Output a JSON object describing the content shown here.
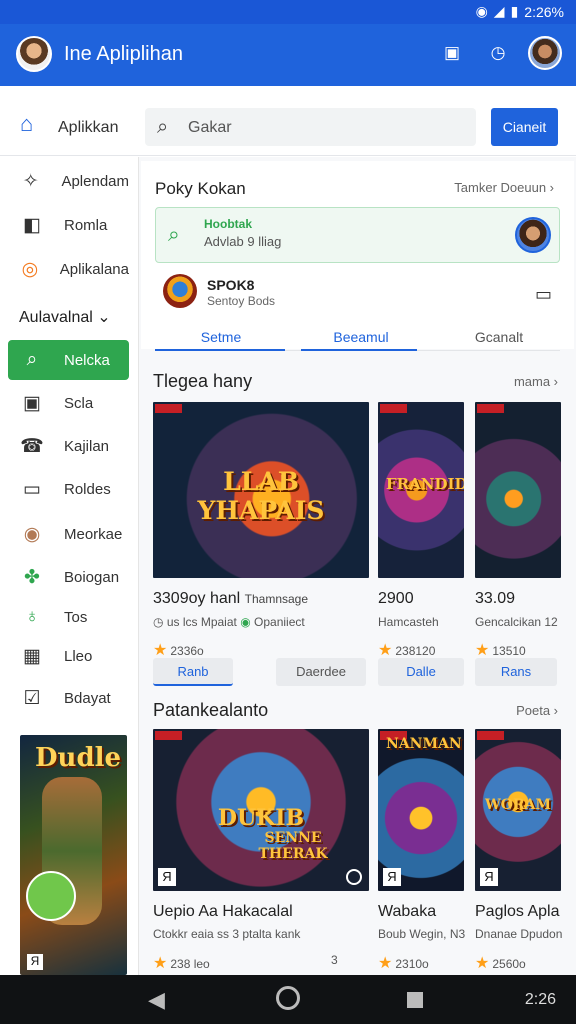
{
  "status": {
    "battery": "2:26%"
  },
  "app": {
    "title": "Ine Apliplihan",
    "icons": [
      "portrait-frame-icon",
      "clock-icon",
      "user-avatar"
    ]
  },
  "top_strip": {
    "label": "Aplikkan",
    "search_placeholder": "Gakar",
    "button": "Cianeit"
  },
  "sidebar": {
    "items": [
      {
        "label": "Aplendam",
        "icon": "puzzle-icon"
      },
      {
        "label": "Romla",
        "icon": "lock-icon"
      },
      {
        "label": "Aplikalana",
        "icon": "refresh-icon"
      }
    ],
    "section": "Aulavalnal",
    "more_items": [
      {
        "label": "Nelcka",
        "icon": "search-icon",
        "active": true
      },
      {
        "label": "Scla",
        "icon": "inbox-icon"
      },
      {
        "label": "Kajilan",
        "icon": "phone-icon"
      },
      {
        "label": "Roldes",
        "icon": "card-icon"
      },
      {
        "label": "Meorkae",
        "icon": "avatar-icon"
      },
      {
        "label": "Boiogan",
        "icon": "puzzle-icon"
      },
      {
        "label": "Tos",
        "icon": "pin-icon"
      },
      {
        "label": "Lleo",
        "icon": "grid-icon"
      },
      {
        "label": "Bdayat",
        "icon": "check-icon"
      }
    ],
    "promo_title": "Dudle"
  },
  "header_card": {
    "title": "Poky Kokan",
    "link": "Tamker Doeuun ›",
    "notice_heading": "Hoobtak",
    "notice_text": "Advlab 9 lliag",
    "row_title": "SPOK8",
    "row_sub": "Sentoy Bods",
    "tabs": [
      "Setme",
      "Beeamul",
      "Gcanalt"
    ]
  },
  "section1": {
    "title": "Tlegea hany",
    "link": "mama ›",
    "games": [
      {
        "cover_text": "LLAB YHAPAIS",
        "title": "3309oy hanl",
        "title_extra": "Thamnsage",
        "sub": "us lcs Mpaiat",
        "sub_extra": "Opaniiect",
        "rating": "2336o",
        "btn": "Ranb",
        "btn2": "Daerdee"
      },
      {
        "cover_text": "FRANDIDER",
        "title": "2900",
        "sub": "Hamcasteh",
        "rating": "238120",
        "btn": "Dalle"
      },
      {
        "title": "33.09",
        "sub": "Gencalcikan 12",
        "rating": "13510",
        "btn": "Rans"
      }
    ]
  },
  "section2": {
    "title": "Patankealanto",
    "link": "Poeta ›",
    "games": [
      {
        "cover_text": "DUKIB",
        "cover_text2": "SENNE THERAK",
        "title": "Uepio Aa Hakacalal",
        "sub": "Ctokkr eaia ss 3 ptalta kank",
        "rating": "238 leo",
        "side": "3"
      },
      {
        "cover_text": "NANMAN",
        "title": "Wabaka",
        "sub": "Boub Wegin, N3",
        "rating": "2310o"
      },
      {
        "cover_text": "WORAM",
        "title": "Paglos Apla",
        "sub": "Dnanae Dpudon",
        "rating": "2560o"
      }
    ]
  },
  "nav": {
    "time": "2:26"
  }
}
